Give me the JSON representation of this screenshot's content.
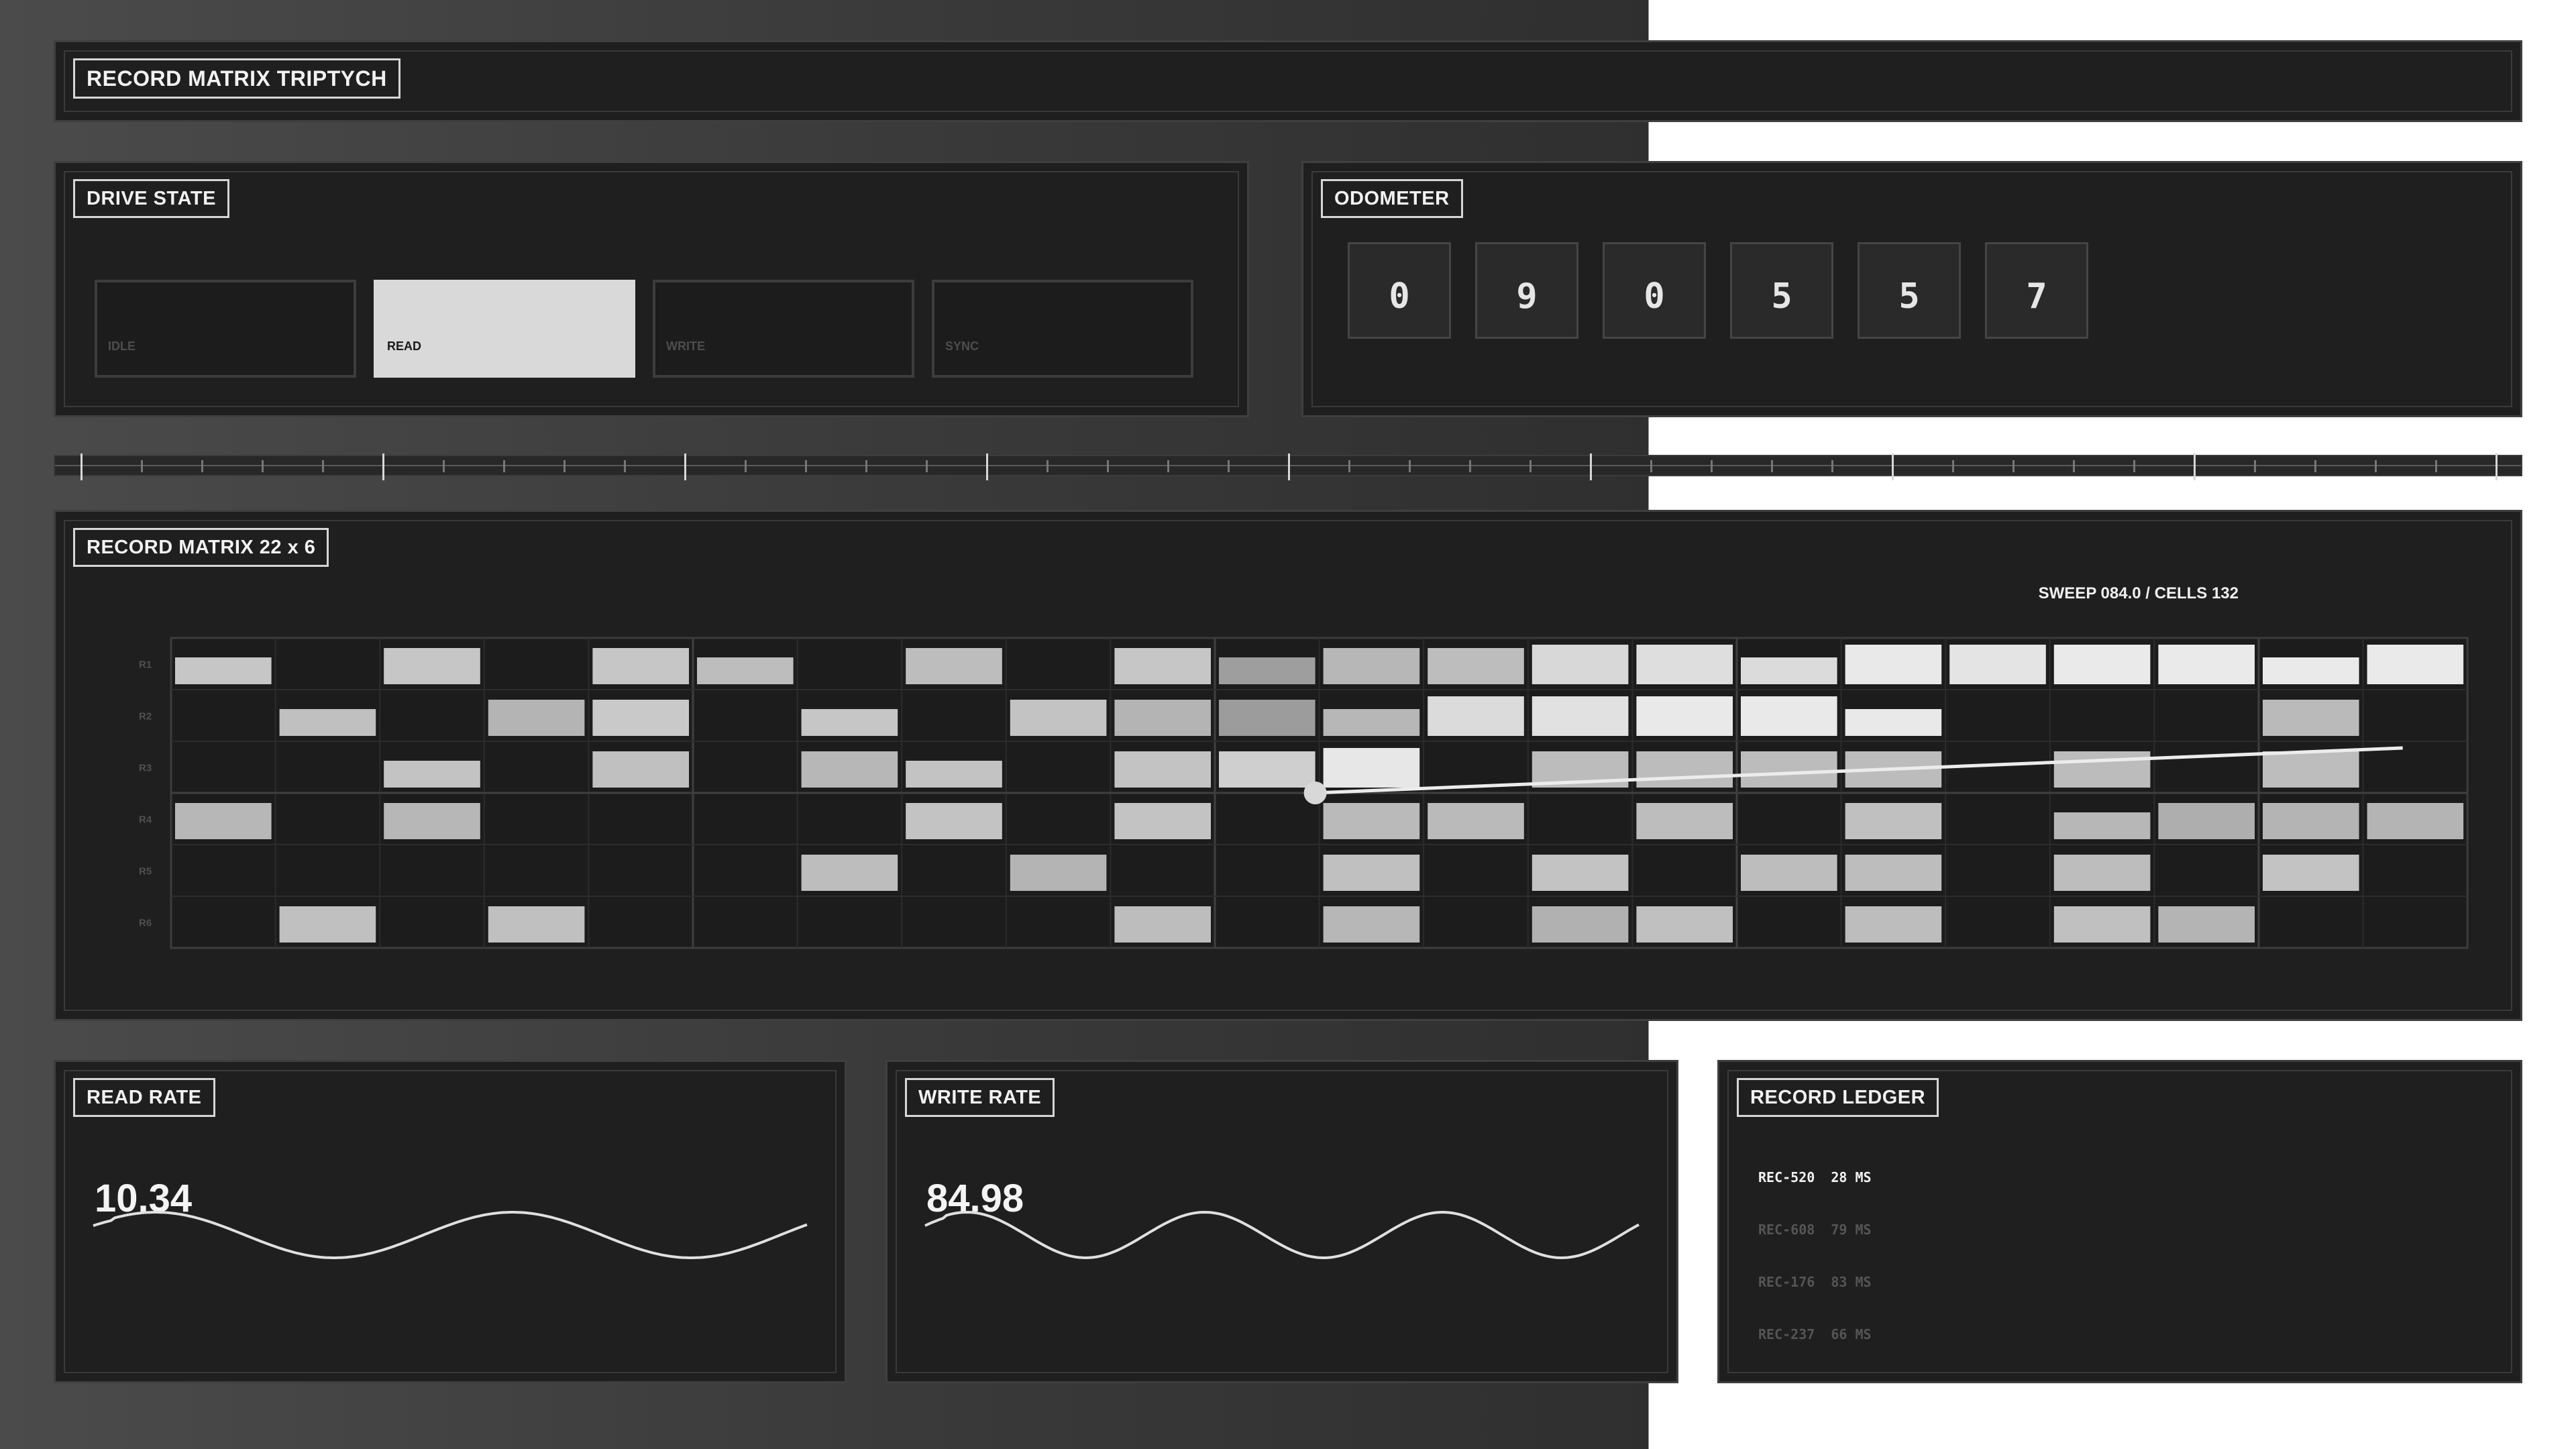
{
  "header": {
    "title": "RECORD MATRIX TRIPTYCH"
  },
  "drive_state": {
    "label": "DRIVE STATE",
    "states": [
      {
        "label": "IDLE",
        "active": false
      },
      {
        "label": "READ",
        "active": true
      },
      {
        "label": "WRITE",
        "active": false
      },
      {
        "label": "SYNC",
        "active": false
      }
    ]
  },
  "odometer": {
    "label": "ODOMETER",
    "digits": [
      "0",
      "9",
      "0",
      "5",
      "5",
      "7"
    ]
  },
  "matrix": {
    "label": "RECORD MATRIX 22 x 6",
    "status": "SWEEP 084.0 / CELLS 132",
    "rows": [
      "R1",
      "R2",
      "R3",
      "R4",
      "R5",
      "R6"
    ],
    "columns": 22,
    "cells": [
      [
        0.72,
        0,
        0.72,
        0,
        0.72,
        0.66,
        0,
        0.66,
        0,
        0.72,
        0.45,
        0.62,
        0.66,
        0.84,
        0.88,
        0.86,
        0.95,
        0.92,
        0.96,
        0.96,
        0.96,
        0.96
      ],
      [
        0,
        0.68,
        0,
        0.6,
        0.74,
        0,
        0.72,
        0,
        0.7,
        0.6,
        0.44,
        0.62,
        0.86,
        0.9,
        0.95,
        0.95,
        0.95,
        0,
        0,
        0,
        0.64,
        0
      ],
      [
        0,
        0,
        0.7,
        0,
        0.68,
        0,
        0.62,
        0.7,
        0,
        0.7,
        0.78,
        0.94,
        0,
        0.65,
        0.65,
        0.65,
        0.65,
        0,
        0.65,
        0,
        0.66,
        0
      ],
      [
        0.62,
        0,
        0.62,
        0,
        0,
        0,
        0,
        0.7,
        0,
        0.7,
        0,
        0.64,
        0.64,
        0,
        0.66,
        0,
        0.68,
        0,
        0.62,
        0.56,
        0.6,
        0.6
      ],
      [
        0,
        0,
        0,
        0,
        0,
        0,
        0.66,
        0,
        0.6,
        0,
        0,
        0.68,
        0,
        0.7,
        0,
        0.66,
        0.66,
        0,
        0.66,
        0,
        0.7,
        0
      ],
      [
        0,
        0.68,
        0,
        0.68,
        0,
        0,
        0,
        0,
        0,
        0.66,
        0,
        0.62,
        0,
        0.58,
        0.68,
        0,
        0.66,
        0,
        0.68,
        0.6,
        0,
        0
      ]
    ],
    "sweep_column": 11
  },
  "read_rate": {
    "label": "READ RATE",
    "value": "10.34"
  },
  "write_rate": {
    "label": "WRITE RATE",
    "value": "84.98"
  },
  "ledger": {
    "label": "RECORD LEDGER",
    "entries": [
      {
        "id": "REC-520",
        "latency": "28 MS",
        "active": true
      },
      {
        "id": "REC-608",
        "latency": "79 MS",
        "active": false
      },
      {
        "id": "REC-176",
        "latency": "83 MS",
        "active": false
      },
      {
        "id": "REC-237",
        "latency": "66 MS",
        "active": false
      }
    ]
  },
  "colors": {
    "accent": "#d9d9d9",
    "panel": "#1f1f1f",
    "border": "#3f3f3f"
  }
}
